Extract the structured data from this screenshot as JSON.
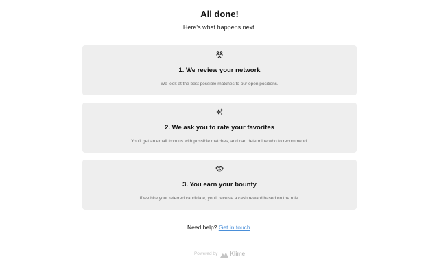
{
  "header": {
    "title": "All done!",
    "subtitle": "Here's what happens next."
  },
  "steps": [
    {
      "icon": "people-network-icon",
      "title": "1. We review your network",
      "description": "We look at the best possible matches to our open positions."
    },
    {
      "icon": "sparkles-icon",
      "title": "2. We ask you to rate your favorites",
      "description": "You'll get an email from us with possible matches, and can determine who to recommend."
    },
    {
      "icon": "handshake-icon",
      "title": "3. You earn your bounty",
      "description": "If we hire your referred candidate, you'll receive a cash reward based on the role."
    }
  ],
  "help": {
    "prefix": "Need help?",
    "link_label": "Get in touch",
    "suffix": "."
  },
  "footer": {
    "powered_by": "Powered by",
    "brand": "Klime",
    "brand_icon": "mountain-logo-icon"
  },
  "colors": {
    "card_background": "#eeeeee",
    "link": "#4a8fd9",
    "muted_text": "#6b6b6b",
    "footer_text": "#c4c4c4"
  }
}
